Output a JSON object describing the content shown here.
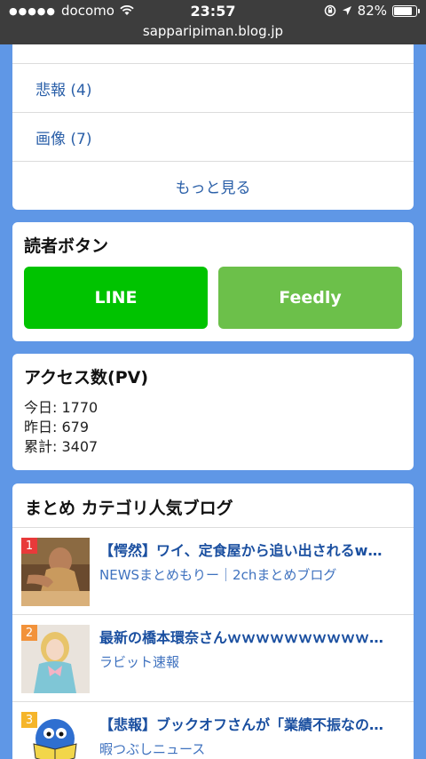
{
  "status_bar": {
    "carrier": "docomo",
    "time": "23:57",
    "battery": "82%",
    "battery_level": 0.82,
    "url": "sapparipiman.blog.jp"
  },
  "categories": {
    "items": [
      {
        "label": "悲報 (4)"
      },
      {
        "label": "画像 (7)"
      }
    ],
    "more_label": "もっと見る"
  },
  "reader": {
    "title": "読者ボタン",
    "line_label": "LINE",
    "feedly_label": "Feedly"
  },
  "access": {
    "title": "アクセス数(PV)",
    "today": "今日: 1770",
    "yesterday": "昨日: 679",
    "total": "累計: 3407"
  },
  "ranking": {
    "title": "まとめ カテゴリ人気ブログ",
    "items": [
      {
        "rank": "1",
        "title": "【愕然】ワイ、定食屋から追い出されるw…",
        "source": "NEWSまとめもりー｜2chまとめブログ",
        "rank_color": "#e83a3a"
      },
      {
        "rank": "2",
        "title": "最新の橋本環奈さんｗｗｗｗｗｗｗｗｗｗ…",
        "source": "ラビット速報",
        "rank_color": "#f2923a"
      },
      {
        "rank": "3",
        "title": "【悲報】ブックオフさんが「業績不振なの…",
        "source": "暇つぶしニュース",
        "rank_color": "#f5b52a"
      }
    ]
  }
}
